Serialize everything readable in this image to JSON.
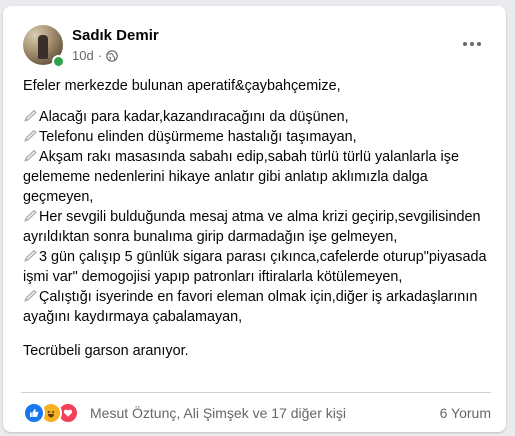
{
  "post": {
    "author": "Sadık Demir",
    "time": "10d",
    "separator": "·",
    "privacy_icon": "globe-icon",
    "more_icon": "more-options-icon",
    "more_label": "•••",
    "intro": "Efeler merkezde bulunan aperatif&çaybahçemize,",
    "bullet_icon": "pencil-icon",
    "items": [
      "Alacağı para kadar,kazandıracağını da düşünen,",
      "Telefonu elinden düşürmeme hastalığı taşımayan,",
      "Akşam rakı masasında sabahı edip,sabah türlü türlü yalanlarla işe gelememe nedenlerini hikaye anlatır gibi anlatıp aklımızla dalga geçmeyen,",
      "Her sevgili bulduğunda mesaj atma ve alma krizi geçirip,sevgilisinden ayrıldıktan sonra bunalıma girip darmadağın işe gelmeyen,",
      "3 gün çalışıp 5 günlük sigara parası çıkınca,cafelerde oturup\"piyasada işmi var\" demogojisi yapıp patronları iftiralarla kötülemeyen,",
      "Çalıştığı isyerinde en favori eleman olmak için,diğer iş arkadaşlarının ayağını kaydırmaya çabalamayan,"
    ],
    "closing": "Tecrübeli garson aranıyor."
  },
  "footer": {
    "reactions": [
      "like",
      "haha",
      "love"
    ],
    "reactors": "Mesut Öztunç, Ali Şimşek ve 17 diğer kişi",
    "comments": "6 Yorum"
  },
  "colors": {
    "like": "#1877f2",
    "haha": "#f7b125",
    "love": "#f33e58",
    "online": "#31a24c",
    "secondary_text": "#65676b"
  }
}
